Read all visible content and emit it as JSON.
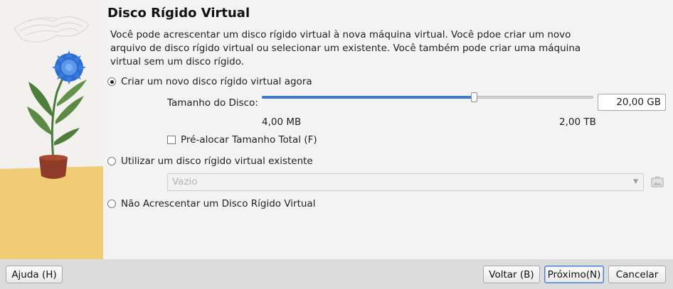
{
  "header": {
    "title": "Disco Rígido Virtual"
  },
  "description": "Você pode acrescentar um disco rígido virtual à nova máquina virtual. Você pdoe criar um novo arquivo de disco rígido virtual ou selecionar um existente. Você também pode criar uma máquina virtual sem um disco rígido.",
  "options": {
    "create_new": {
      "label": "Criar um novo disco rígido virtual agora",
      "checked": true
    },
    "use_existing": {
      "label": "Utilizar um disco rígido virtual existente",
      "checked": false
    },
    "no_disk": {
      "label": "Não Acrescentar um Disco Rígido Virtual",
      "checked": false
    }
  },
  "disk_size": {
    "label": "Tamanho do Disco:",
    "value": "20,00 GB",
    "min_label": "4,00 MB",
    "max_label": "2,00 TB",
    "slider_fraction": 0.64
  },
  "preallocate": {
    "label": "Pré-alocar Tamanho Total (F)",
    "checked": false
  },
  "existing_disk": {
    "value": "Vazio"
  },
  "footer": {
    "help_label": "Ajuda (H)",
    "back_label": "Voltar (B)",
    "next_label": "Próximo(N)",
    "cancel_label": "Cancelar"
  },
  "colors": {
    "accent": "#3e7bd0",
    "art_background": "#efefef",
    "art_floor": "#f0cd74"
  }
}
